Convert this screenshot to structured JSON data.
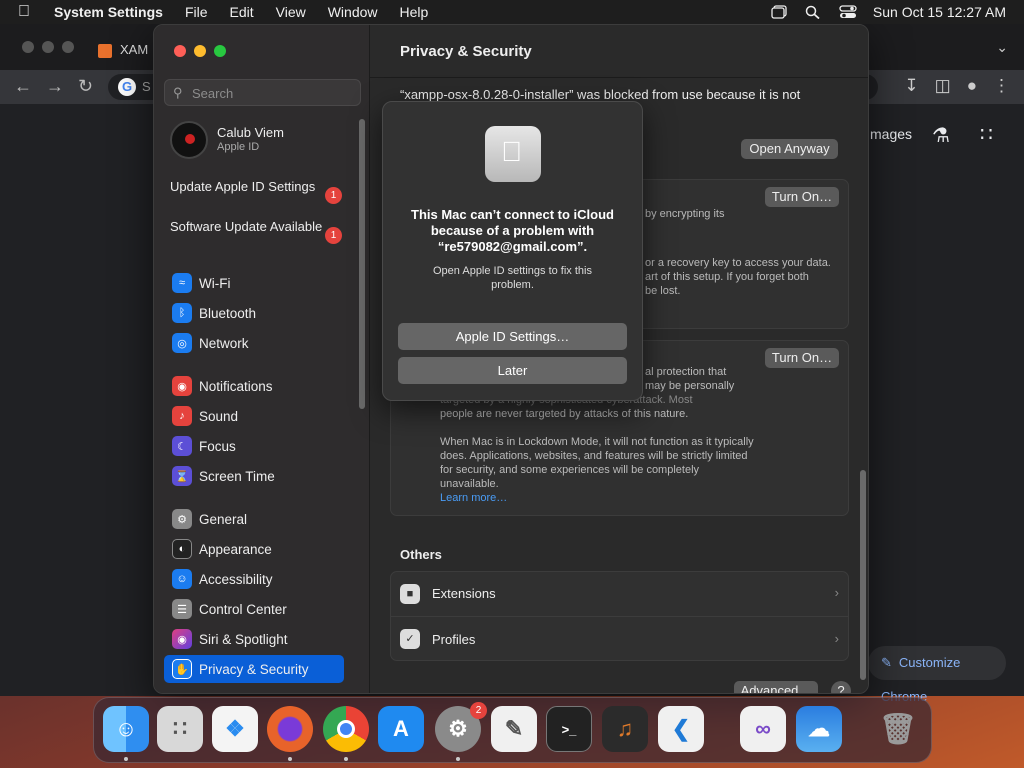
{
  "menubar": {
    "app": "System Settings",
    "items": [
      "File",
      "Edit",
      "View",
      "Window",
      "Help"
    ],
    "datetime": "Sun Oct 15  12:27 AM"
  },
  "chrome": {
    "tab_label": "XAM",
    "omnibox_text": "S",
    "images_link": "mages",
    "customize_label": "Customize Chrome"
  },
  "sidebar": {
    "search_placeholder": "Search",
    "account": {
      "name": "Calub Viem",
      "sub": "Apple ID"
    },
    "notices": [
      {
        "label": "Update Apple ID Settings",
        "badge": "1"
      },
      {
        "label": "Software Update Available",
        "badge": "1"
      }
    ],
    "items": [
      {
        "label": "Wi-Fi",
        "icon": "wifi-icon",
        "color": "#1b7cf0"
      },
      {
        "label": "Bluetooth",
        "icon": "bluetooth-icon",
        "color": "#1b7cf0"
      },
      {
        "label": "Network",
        "icon": "globe-icon",
        "color": "#1b7cf0"
      },
      {
        "label": "Notifications",
        "icon": "bell-icon",
        "color": "#e5433d"
      },
      {
        "label": "Sound",
        "icon": "speaker-icon",
        "color": "#e5433d"
      },
      {
        "label": "Focus",
        "icon": "moon-icon",
        "color": "#5c4fd6"
      },
      {
        "label": "Screen Time",
        "icon": "hourglass-icon",
        "color": "#5c4fd6"
      },
      {
        "label": "General",
        "icon": "gear-icon",
        "color": "#888888"
      },
      {
        "label": "Appearance",
        "icon": "appearance-icon",
        "color": "#222222"
      },
      {
        "label": "Accessibility",
        "icon": "accessibility-icon",
        "color": "#1b7cf0"
      },
      {
        "label": "Control Center",
        "icon": "control-center-icon",
        "color": "#888888"
      },
      {
        "label": "Siri & Spotlight",
        "icon": "siri-icon",
        "color": "#a23cc8"
      },
      {
        "label": "Privacy & Security",
        "icon": "hand-icon",
        "color": "#1b7cf0"
      }
    ]
  },
  "main": {
    "title": "Privacy & Security",
    "blocked_text": "“xampp-osx-8.0.28-0-installer” was blocked from use because it is not",
    "open_anyway": "Open Anyway",
    "turn_on_1": "Turn On…",
    "turn_on_2": "Turn On…",
    "filevault_partial": "by encrypting its",
    "recovery_partial_1": "or a recovery key to access your data.",
    "recovery_partial_2": "art of this setup. If you forget both",
    "recovery_partial_3": "be lost.",
    "lockdown_partial_1": "al protection that",
    "lockdown_partial_2": "may be personally",
    "lockdown_partial_3": "targeted by a highly sophisticated cyberattack. Most",
    "lockdown_partial_4": "people are never targeted by attacks of this nature.",
    "lockdown_body": "When Mac is in Lockdown Mode, it will not function as it typically does. Applications, websites, and features will be strictly limited for security, and some experiences will be completely unavailable.",
    "learn_more": "Learn more…",
    "others_header": "Others",
    "others": [
      {
        "label": "Extensions",
        "icon": "extensions-icon"
      },
      {
        "label": "Profiles",
        "icon": "profiles-icon"
      }
    ],
    "advanced": "Advanced…",
    "help": "?"
  },
  "dialog": {
    "title": "This Mac can’t connect to iCloud because of a problem with “re579082@gmail.com”.",
    "message": "Open Apple ID settings to fix this problem.",
    "primary": "Apple ID Settings…",
    "secondary": "Later"
  },
  "dock": {
    "settings_badge": "2",
    "apps": [
      {
        "name": "finder-icon",
        "color": "#2f8ef0"
      },
      {
        "name": "launchpad-icon",
        "color": "#d0d0d0"
      },
      {
        "name": "safari-icon",
        "color": "#2a8cf0"
      },
      {
        "name": "firefox-icon",
        "color": "#e8632a"
      },
      {
        "name": "chrome-icon",
        "color": "#e8e8e8"
      },
      {
        "name": "app-store-icon",
        "color": "#1f8af0"
      },
      {
        "name": "system-settings-icon",
        "color": "#8a8a8a"
      },
      {
        "name": "textedit-icon",
        "color": "#f0f0f0"
      },
      {
        "name": "terminal-icon",
        "color": "#222222"
      },
      {
        "name": "garageband-icon",
        "color": "#e07a2a"
      },
      {
        "name": "vscode-icon",
        "color": "#f0f0f0"
      },
      {
        "name": "visual-studio-icon",
        "color": "#f0f0f0"
      },
      {
        "name": "weather-icon",
        "color": "#2a7de0"
      },
      {
        "name": "trash-icon",
        "color": "#9a9a9a"
      }
    ]
  }
}
